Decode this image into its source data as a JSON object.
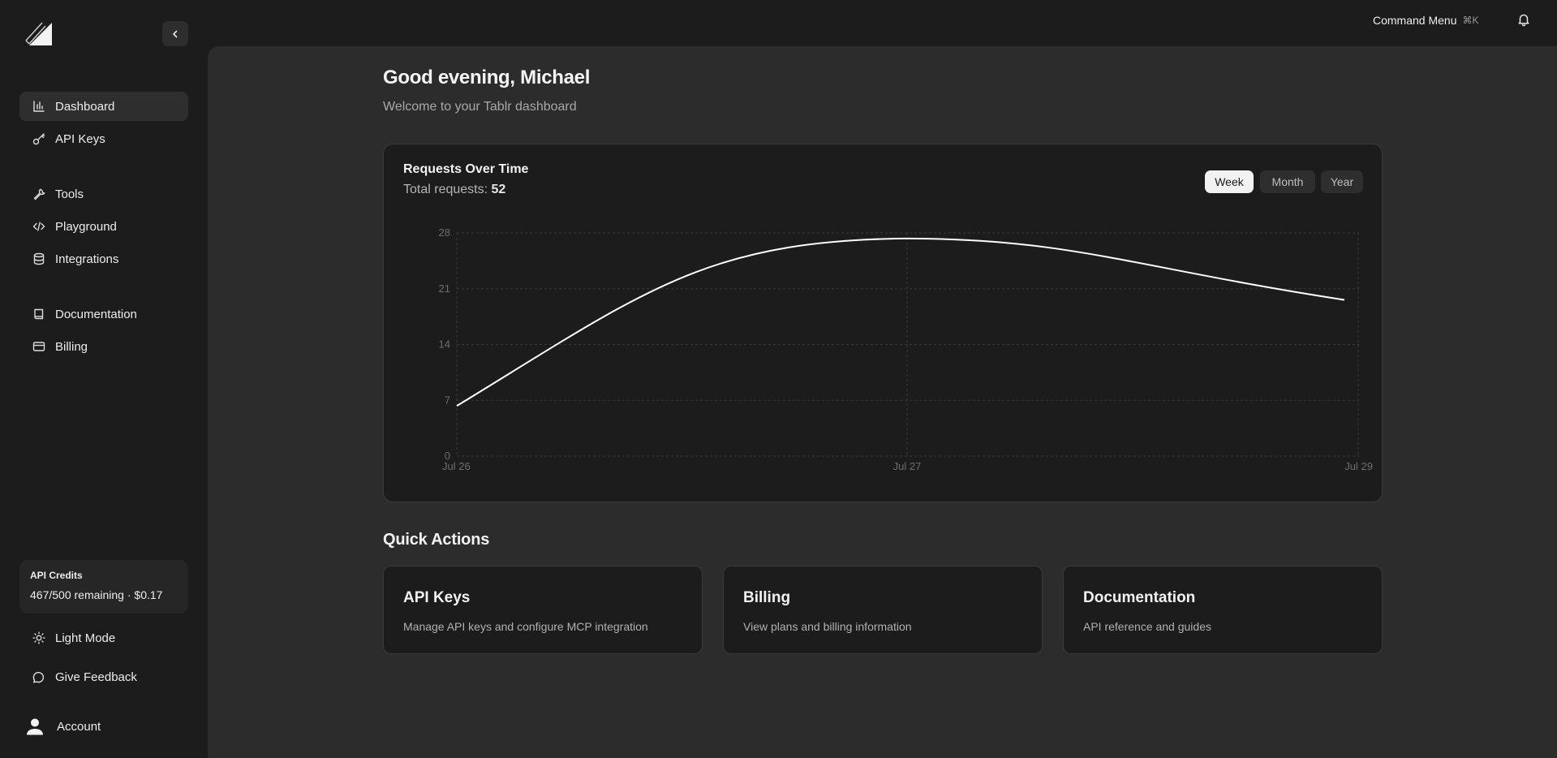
{
  "sidebar": {
    "collapse_icon": "chevron-left-icon",
    "items": [
      {
        "label": "Dashboard",
        "icon": "bar-chart-icon",
        "active": true
      },
      {
        "label": "API Keys",
        "icon": "key-icon"
      },
      {
        "label": "Tools",
        "icon": "wrench-icon"
      },
      {
        "label": "Playground",
        "icon": "code-icon"
      },
      {
        "label": "Integrations",
        "icon": "database-icon"
      },
      {
        "label": "Documentation",
        "icon": "book-icon"
      },
      {
        "label": "Billing",
        "icon": "credit-card-icon"
      }
    ],
    "credits": {
      "title": "API Credits",
      "value": "467/500 remaining · $0.17"
    },
    "bottom": {
      "light_mode": "Light Mode",
      "feedback": "Give Feedback",
      "account": "Account"
    }
  },
  "topbar": {
    "command_menu": "Command Menu",
    "shortcut": "⌘K",
    "bell_icon": "bell-icon"
  },
  "main": {
    "greeting": "Good evening, Michael",
    "subtitle": "Welcome to your Tablr dashboard",
    "chart_card": {
      "title": "Requests Over Time",
      "total_label": "Total requests:",
      "total_value": "52",
      "ranges": [
        "Week",
        "Month",
        "Year"
      ],
      "active_range": "Week"
    },
    "quick_actions": {
      "title": "Quick Actions",
      "cards": [
        {
          "title": "API Keys",
          "desc": "Manage API keys and configure MCP integration"
        },
        {
          "title": "Billing",
          "desc": "View plans and billing information"
        },
        {
          "title": "Documentation",
          "desc": "API reference and guides"
        }
      ]
    }
  },
  "chart_data": {
    "type": "line",
    "title": "Requests Over Time",
    "x": [
      "Jul 26",
      "Jul 27",
      "Jul 29"
    ],
    "series": [
      {
        "values": [
          6.3,
          27.3,
          19.6
        ]
      }
    ],
    "ylim": [
      0,
      28
    ],
    "yticks": [
      0,
      7,
      14,
      21,
      28
    ],
    "grid": true,
    "line_color": "#ffffff"
  }
}
